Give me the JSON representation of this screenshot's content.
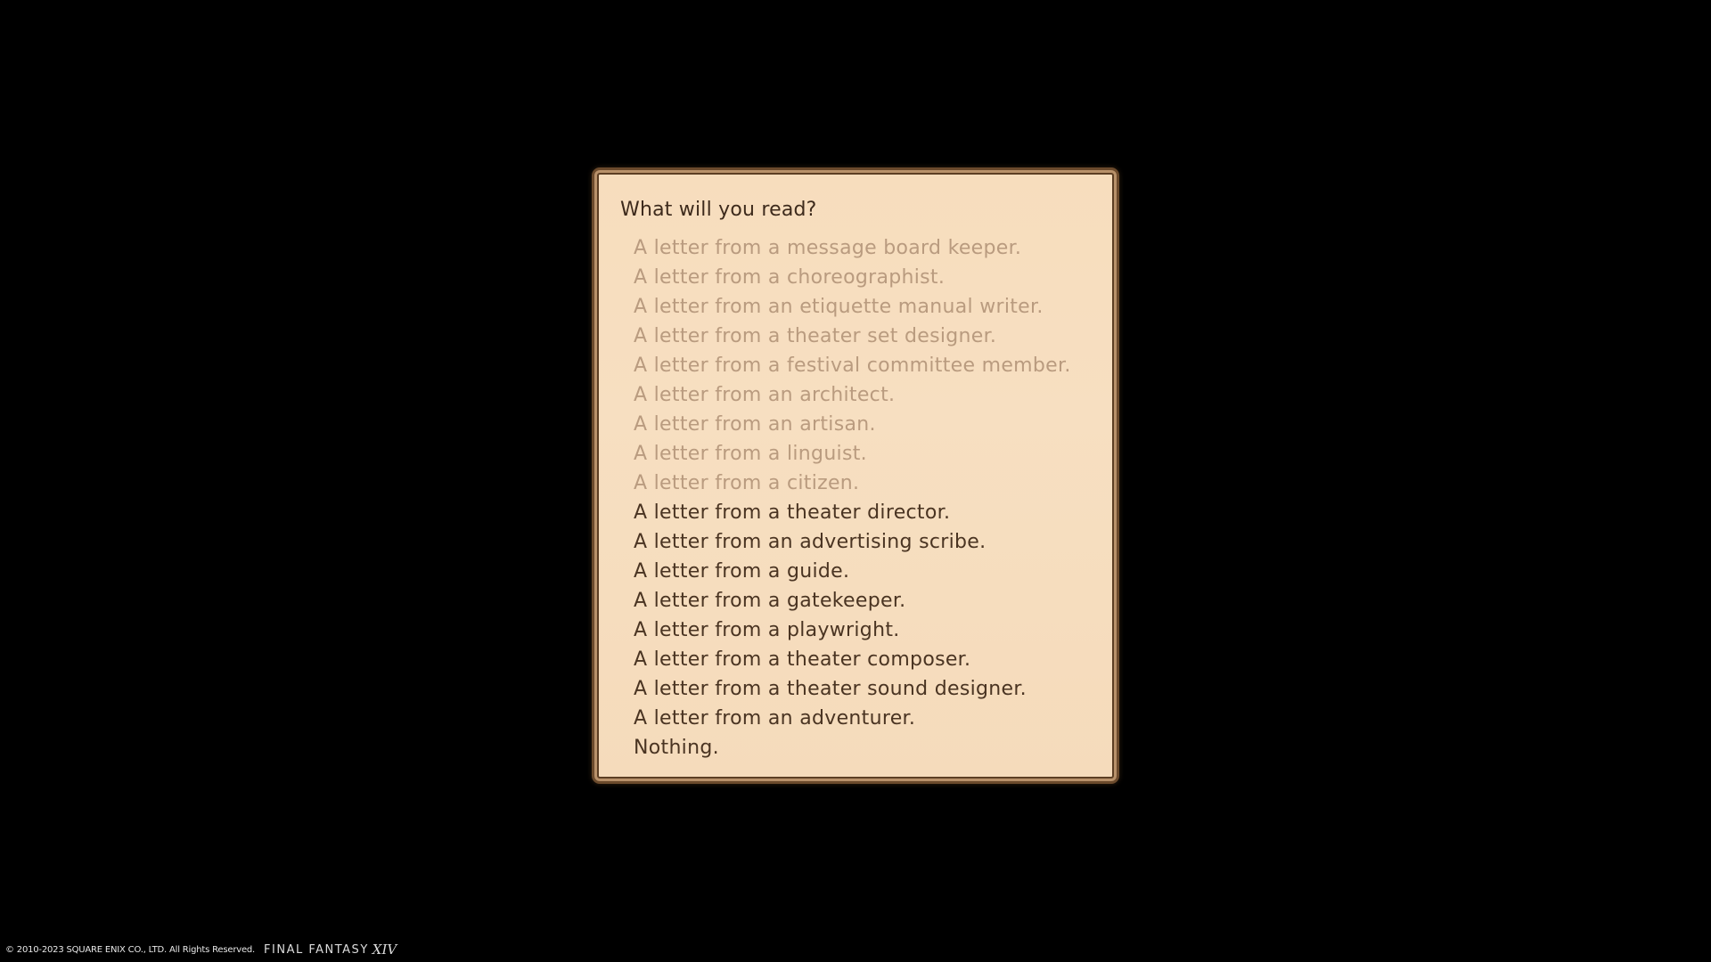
{
  "dialog": {
    "prompt": "What will you read?",
    "options": [
      {
        "label": "A letter from a message board keeper.",
        "read": true
      },
      {
        "label": "A letter from a choreographist.",
        "read": true
      },
      {
        "label": "A letter from an etiquette manual writer.",
        "read": true
      },
      {
        "label": "A letter from a theater set designer.",
        "read": true
      },
      {
        "label": "A letter from a festival committee member.",
        "read": true
      },
      {
        "label": "A letter from an architect.",
        "read": true
      },
      {
        "label": "A letter from an artisan.",
        "read": true
      },
      {
        "label": "A letter from a linguist.",
        "read": true
      },
      {
        "label": "A letter from a citizen.",
        "read": true
      },
      {
        "label": "A letter from a theater director.",
        "read": false
      },
      {
        "label": "A letter from an advertising scribe.",
        "read": false
      },
      {
        "label": "A letter from a guide.",
        "read": false
      },
      {
        "label": "A letter from a gatekeeper.",
        "read": false
      },
      {
        "label": "A letter from a playwright.",
        "read": false
      },
      {
        "label": "A letter from a theater composer.",
        "read": false
      },
      {
        "label": "A letter from a theater sound designer.",
        "read": false
      },
      {
        "label": "A letter from an adventurer.",
        "read": false
      },
      {
        "label": "Nothing.",
        "read": false
      }
    ]
  },
  "footer": {
    "copyright": "© 2010-2023 SQUARE ENIX CO., LTD. All Rights Reserved.",
    "game_title": "FINAL FANTASY",
    "logo_mark": "XIV"
  },
  "colors": {
    "background": "#000000",
    "panel": "#f7ddbd",
    "panel_border": "#6b4a2c",
    "text_read": "#b99b7f",
    "text_unread": "#4a3422",
    "prompt_text": "#3d2a1c"
  }
}
